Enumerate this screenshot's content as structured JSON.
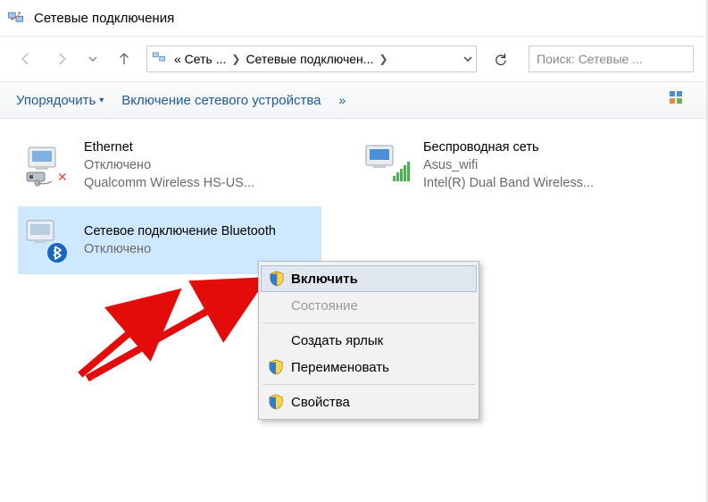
{
  "window": {
    "title": "Сетевые подключения"
  },
  "breadcrumb": {
    "root": "« Сеть ...",
    "current": "Сетевые подключен..."
  },
  "search": {
    "placeholder": "Поиск: Сетевые ..."
  },
  "commandbar": {
    "organize": "Упорядочить",
    "enable_device": "Включение сетевого устройства"
  },
  "adapters": [
    {
      "name": "Ethernet",
      "status": "Отключено",
      "device": "Qualcomm Wireless HS-US..."
    },
    {
      "name": "Беспроводная сеть",
      "status": "Asus_wifi",
      "device": "Intel(R) Dual Band Wireless..."
    },
    {
      "name": "Сетевое подключение Bluetooth",
      "status": "Отключено",
      "device": ""
    }
  ],
  "contextmenu": {
    "enable": "Включить",
    "status": "Состояние",
    "shortcut": "Создать ярлык",
    "rename": "Переименовать",
    "properties": "Свойства"
  }
}
